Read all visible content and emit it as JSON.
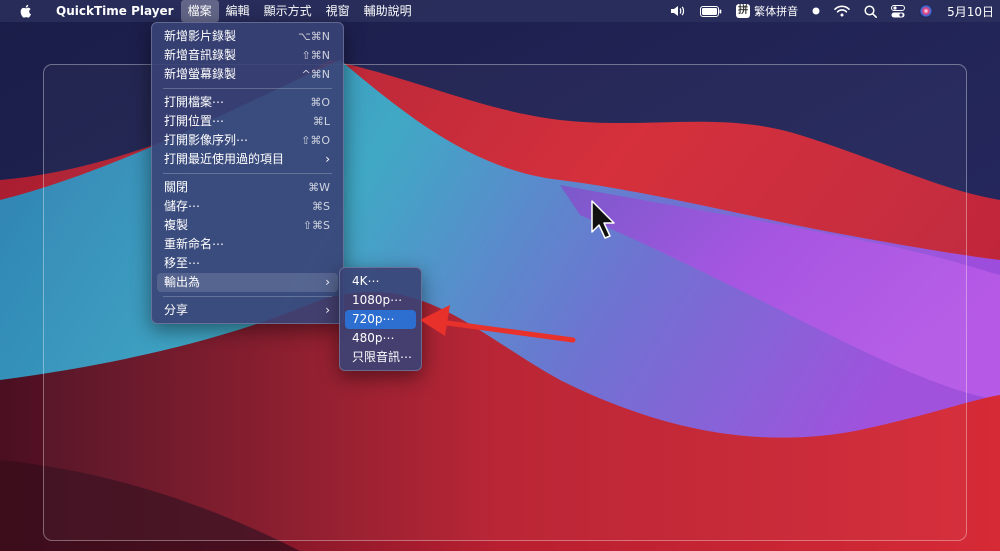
{
  "menubar": {
    "app_name": "QuickTime Player",
    "menus": [
      "檔案",
      "編輯",
      "顯示方式",
      "視窗",
      "輔助說明"
    ],
    "input_method_label": "繁体拼音",
    "input_method_glyph": "拼",
    "clock": "5月10日"
  },
  "file_menu": {
    "items": [
      {
        "label": "新增影片錄製",
        "shortcut": "⌥⌘N"
      },
      {
        "label": "新增音訊錄製",
        "shortcut": "⇧⌘N"
      },
      {
        "label": "新增螢幕錄製",
        "shortcut": "^⌘N"
      },
      {
        "label": "打開檔案⋯",
        "shortcut": "⌘O"
      },
      {
        "label": "打開位置⋯",
        "shortcut": "⌘L"
      },
      {
        "label": "打開影像序列⋯",
        "shortcut": "⇧⌘O"
      },
      {
        "label": "打開最近使用過的項目",
        "submenu_arrow": "›"
      },
      {
        "label": "關閉",
        "shortcut": "⌘W"
      },
      {
        "label": "儲存⋯",
        "shortcut": "⌘S"
      },
      {
        "label": "複製",
        "shortcut": "⇧⌘S"
      },
      {
        "label": "重新命名⋯"
      },
      {
        "label": "移至⋯"
      },
      {
        "label": "輸出為",
        "submenu_arrow": "›",
        "highlighted": true
      },
      {
        "label": "分享",
        "submenu_arrow": "›"
      }
    ]
  },
  "export_submenu": {
    "items": [
      {
        "label": "4K⋯"
      },
      {
        "label": "1080p⋯"
      },
      {
        "label": "720p⋯",
        "selected": true
      },
      {
        "label": "480p⋯"
      },
      {
        "label": "只限音訊⋯"
      }
    ]
  },
  "colors": {
    "selection_blue": "#2c6fd1",
    "annotation_arrow_red": "#e8312a",
    "wallpaper_red": "#c8283a",
    "wallpaper_teal": "#3aa8c8",
    "wallpaper_purple": "#a44fe0",
    "wallpaper_navy": "#1c2150"
  },
  "icons": [
    "apple-logo-icon",
    "volume-icon",
    "battery-icon",
    "input-method-icon",
    "focus-dot-icon",
    "wifi-icon",
    "spotlight-search-icon",
    "control-center-icon",
    "siri-icon",
    "mouse-pointer-icon",
    "annotation-arrow-icon"
  ]
}
